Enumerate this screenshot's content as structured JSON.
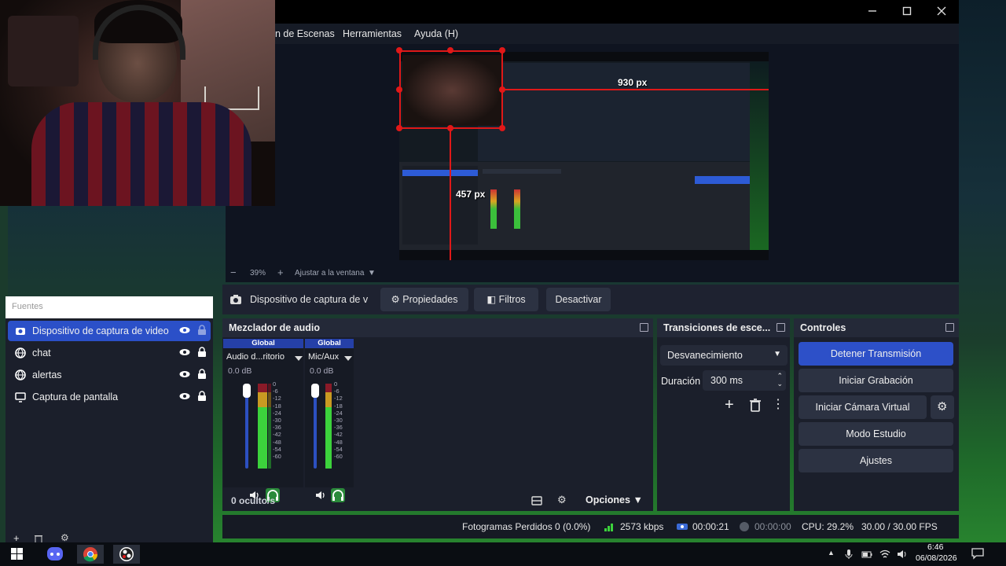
{
  "window": {
    "menu": [
      "n de Escenas",
      "Herramientas",
      "Ayuda (H)"
    ]
  },
  "preview": {
    "width_label": "930 px",
    "height_label": "457 px",
    "zoom_value": "39%",
    "fit_label": "Ajustar a la ventana"
  },
  "source_toolbar": {
    "source_name": "Dispositivo de captura de v",
    "properties_label": "Propiedades",
    "filters_label": "Filtros",
    "deactivate_label": "Desactivar"
  },
  "sources": {
    "header": "Fuentes",
    "items": [
      {
        "label": "Dispositivo de captura de video",
        "icon": "camera-icon",
        "selected": true
      },
      {
        "label": "chat",
        "icon": "globe-icon",
        "selected": false
      },
      {
        "label": "alertas",
        "icon": "globe-icon",
        "selected": false
      },
      {
        "label": "Captura de pantalla",
        "icon": "monitor-icon",
        "selected": false
      }
    ]
  },
  "mixer": {
    "title": "Mezclador de audio",
    "channels": [
      {
        "global": "Global",
        "name": "Audio d...ritorio",
        "db": "0.0 dB"
      },
      {
        "global": "Global",
        "name": "Mic/Aux",
        "db": "0.0 dB"
      }
    ],
    "ticks": [
      "0",
      "-6",
      "-12",
      "-18",
      "-24",
      "-30",
      "-36",
      "-42",
      "-48",
      "-54",
      "-60"
    ],
    "hidden_count": "0 oculto/s",
    "options_label": "Opciones"
  },
  "transitions": {
    "title": "Transiciones de esce...",
    "selected": "Desvanecimiento",
    "duration_label": "Duración",
    "duration_value": "300 ms"
  },
  "controls": {
    "title": "Controles",
    "stop_stream": "Detener Transmisión",
    "start_recording": "Iniciar Grabación",
    "start_virtual_cam": "Iniciar Cámara Virtual",
    "studio_mode": "Modo Estudio",
    "settings": "Ajustes"
  },
  "status": {
    "dropped_frames": "Fotogramas Perdidos 0 (0.0%)",
    "bitrate": "2573 kbps",
    "stream_time": "00:00:21",
    "record_time": "00:00:00",
    "cpu": "CPU: 29.2%",
    "fps": "30.00 / 30.00 FPS"
  },
  "taskbar": {
    "time": "6:46",
    "date": "06/08/2026"
  },
  "colors": {
    "accent": "#2d50c8",
    "panel": "#1b1f2b",
    "red_guide": "#e01818"
  }
}
